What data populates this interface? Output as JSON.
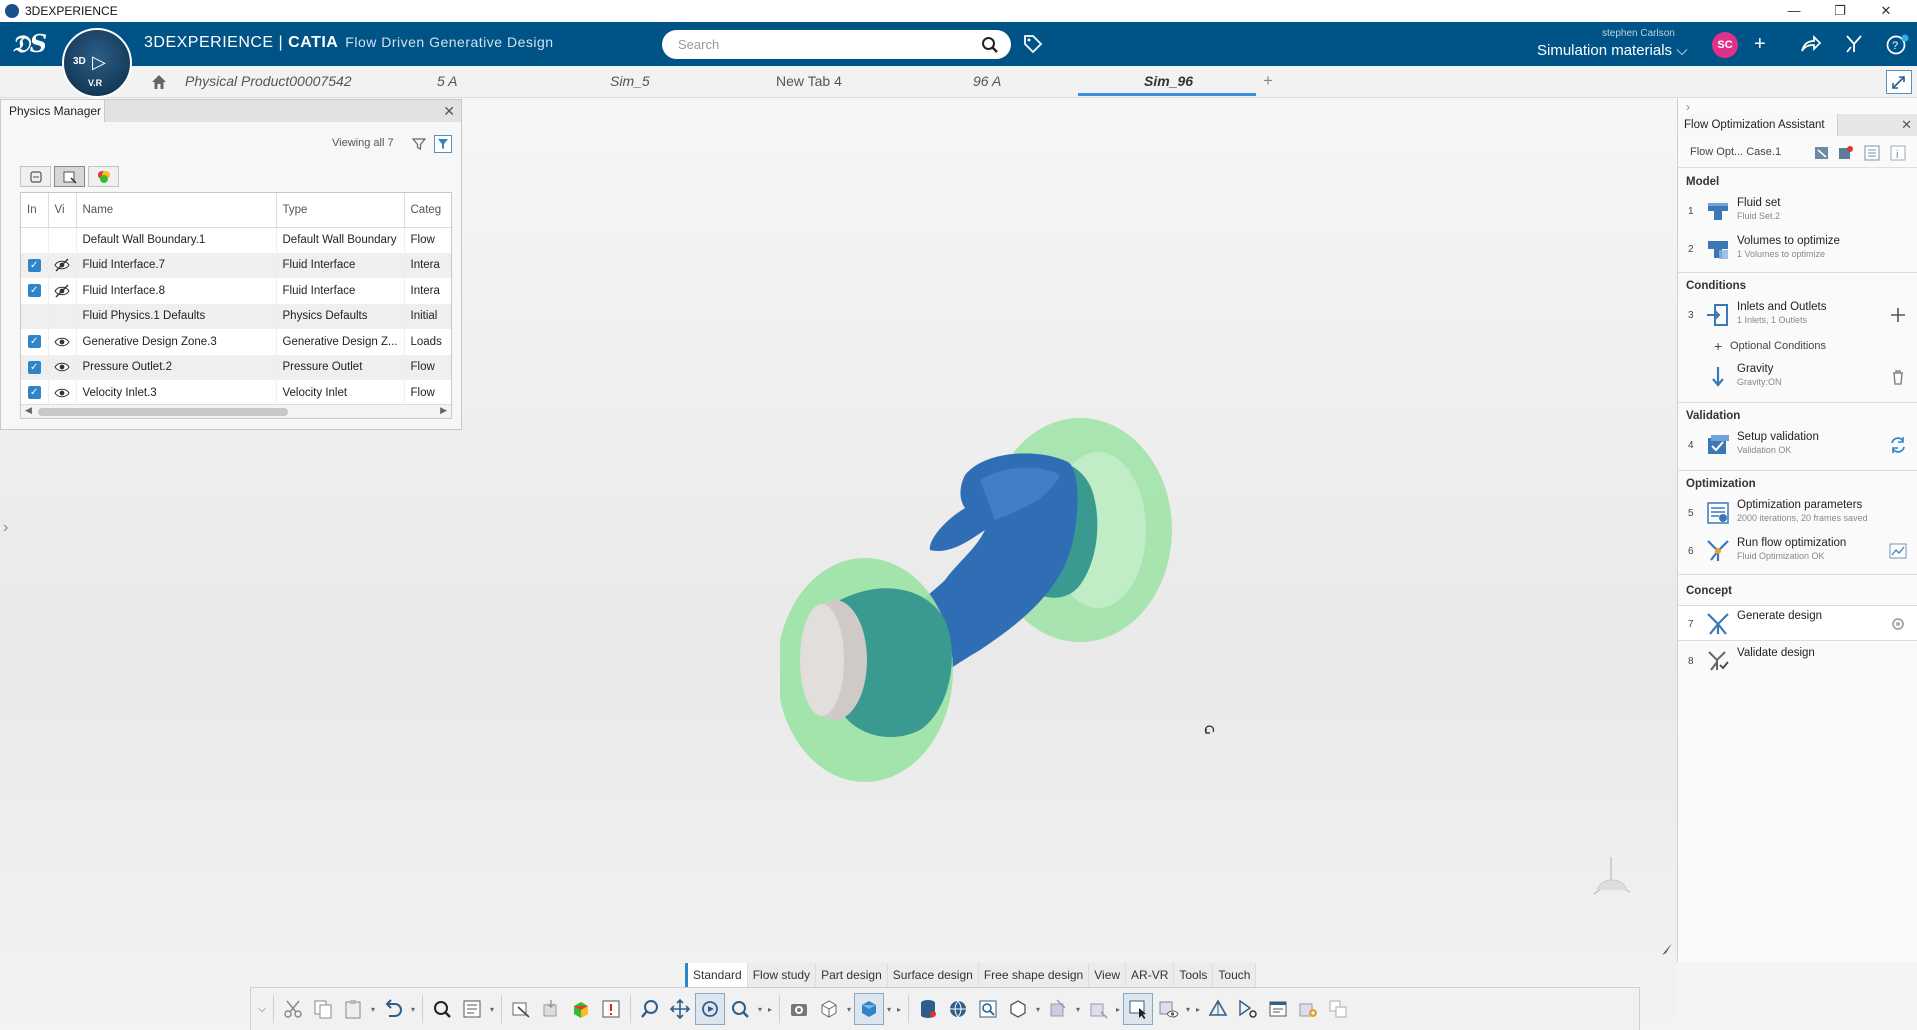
{
  "window": {
    "title": "3DEXPERIENCE"
  },
  "header": {
    "brand_prefix": "3DEXPERIENCE",
    "brand_separator": " | ",
    "brand_app": "CATIA",
    "app_name": "Flow Driven Generative Design",
    "compass_3d": "3D",
    "compass_vr": "V.R",
    "search_placeholder": "Search",
    "user_name": "stephen Carlson",
    "role": "Simulation materials",
    "avatar_initials": "SC"
  },
  "tabs": [
    {
      "label": "Physical Product00007542",
      "active": false
    },
    {
      "label": "5 A",
      "active": false
    },
    {
      "label": "Sim_5",
      "active": false
    },
    {
      "label": "New Tab 4",
      "active": false
    },
    {
      "label": "96 A",
      "active": false
    },
    {
      "label": "Sim_96",
      "active": true
    }
  ],
  "physics_manager": {
    "title": "Physics Manager",
    "viewing": "Viewing all 7",
    "columns": [
      "In",
      "Vi",
      "Name",
      "Type",
      "Categ"
    ],
    "rows": [
      {
        "in": false,
        "vis": "none",
        "name": "Default Wall Boundary.1",
        "type": "Default Wall Boundary",
        "category": "Flow"
      },
      {
        "in": true,
        "vis": "hidden",
        "name": "Fluid Interface.7",
        "type": "Fluid Interface",
        "category": "Intera"
      },
      {
        "in": true,
        "vis": "hidden",
        "name": "Fluid Interface.8",
        "type": "Fluid Interface",
        "category": "Intera"
      },
      {
        "in": false,
        "vis": "none",
        "name": "Fluid Physics.1 Defaults",
        "type": "Physics Defaults",
        "category": "Initial"
      },
      {
        "in": true,
        "vis": "visible",
        "name": "Generative Design Zone.3",
        "type": "Generative Design Z...",
        "category": "Loads"
      },
      {
        "in": true,
        "vis": "visible",
        "name": "Pressure Outlet.2",
        "type": "Pressure Outlet",
        "category": "Flow"
      },
      {
        "in": true,
        "vis": "visible",
        "name": "Velocity Inlet.3",
        "type": "Velocity Inlet",
        "category": "Flow"
      }
    ]
  },
  "assistant": {
    "title": "Flow Optimization Assistant",
    "case_label": "Flow Opt... Case.1",
    "sections": {
      "model": "Model",
      "conditions": "Conditions",
      "validation": "Validation",
      "optimization": "Optimization",
      "concept": "Concept"
    },
    "items": {
      "fluid_set": {
        "num": "1",
        "title": "Fluid set",
        "sub": "Fluid Set.2"
      },
      "volumes": {
        "num": "2",
        "title": "Volumes to optimize",
        "sub": "1 Volumes to optimize"
      },
      "inlets": {
        "num": "3",
        "title": "Inlets and Outlets",
        "sub": "1 Inlets, 1 Outlets"
      },
      "optional": {
        "title": "Optional Conditions"
      },
      "gravity": {
        "title": "Gravity",
        "sub": "Gravity:ON"
      },
      "setup_validation": {
        "num": "4",
        "title": "Setup validation",
        "sub": "Validation OK"
      },
      "opt_params": {
        "num": "5",
        "title": "Optimization parameters",
        "sub": "2000 iterations, 20 frames saved"
      },
      "run_flow": {
        "num": "6",
        "title": "Run flow optimization",
        "sub": "Fluid Optimization OK"
      },
      "generate": {
        "num": "7",
        "title": "Generate design"
      },
      "validate": {
        "num": "8",
        "title": "Validate design"
      }
    }
  },
  "ribbon_tabs": [
    {
      "label": "Standard",
      "active": true
    },
    {
      "label": "Flow study",
      "active": false
    },
    {
      "label": "Part design",
      "active": false
    },
    {
      "label": "Surface design",
      "active": false
    },
    {
      "label": "Free shape design",
      "active": false
    },
    {
      "label": "View",
      "active": false
    },
    {
      "label": "AR-VR",
      "active": false
    },
    {
      "label": "Tools",
      "active": false
    },
    {
      "label": "Touch",
      "active": false
    }
  ],
  "colors": {
    "topbar": "#005386",
    "accent": "#2e86c9",
    "fluid_blue": "#2f6db5",
    "teal": "#3a9a8f",
    "zone_green": "#9be3a5",
    "cylinder_grey": "#d8d4d2",
    "avatar": "#e0318a"
  }
}
